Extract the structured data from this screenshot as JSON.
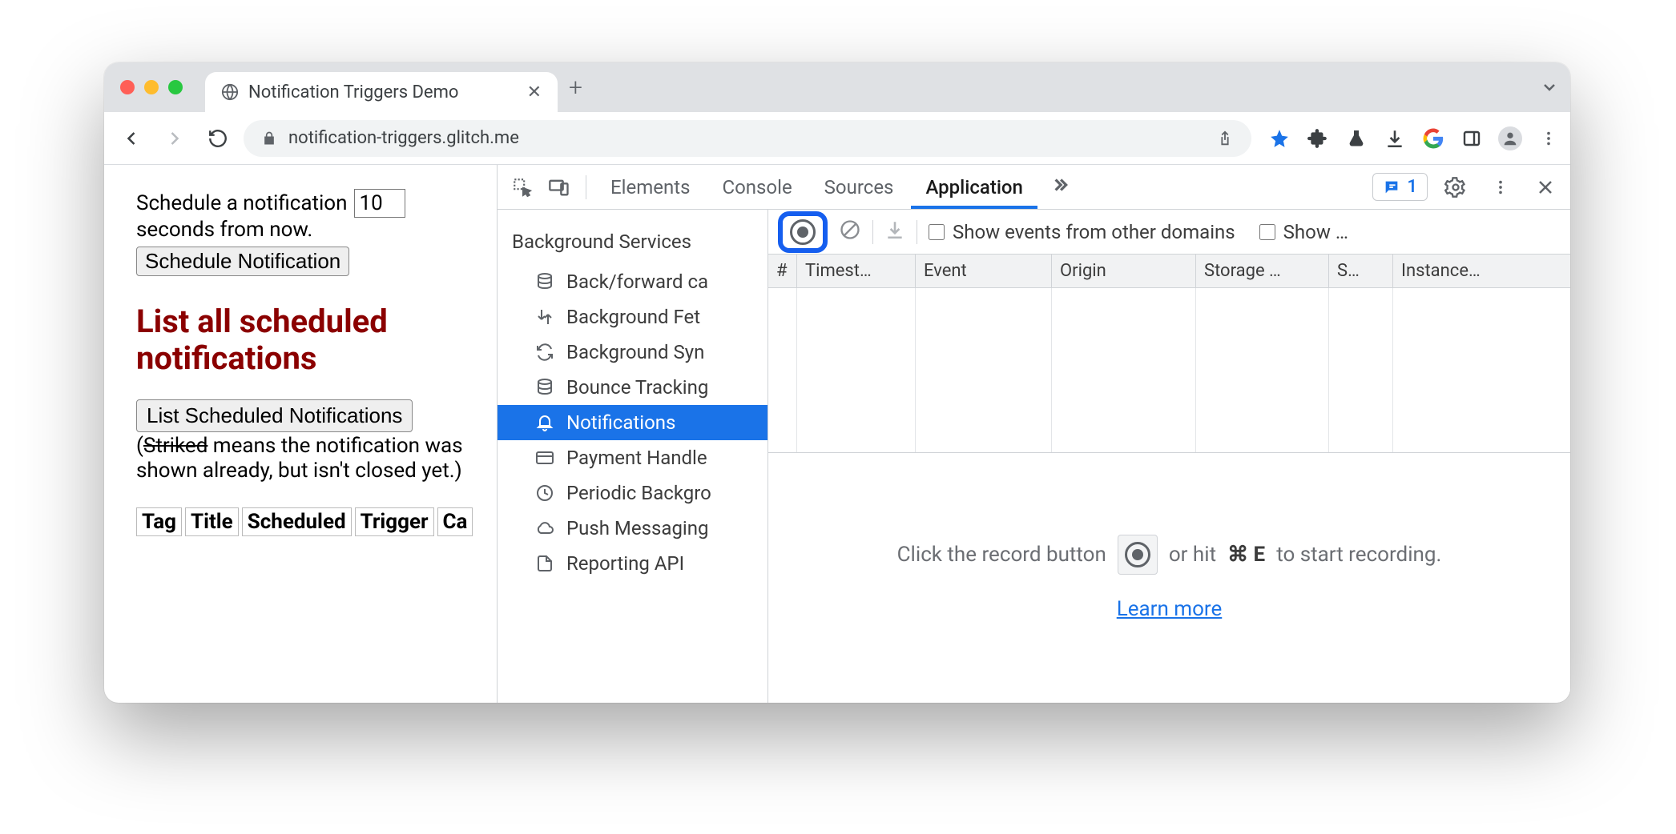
{
  "tab": {
    "title": "Notification Triggers Demo"
  },
  "omnibox": {
    "url": "notification-triggers.glitch.me"
  },
  "page": {
    "schedule_text_a": "Schedule a notification",
    "schedule_seconds": "10",
    "schedule_text_b": "seconds from now.",
    "schedule_button": "Schedule Notification",
    "heading": "List all scheduled notifications",
    "list_button": "List Scheduled Notifications",
    "note_open": "(",
    "note_striked": "Striked",
    "note_rest": " means the notification was shown already, but isn't closed yet.)",
    "thead": [
      "Tag",
      "Title",
      "Scheduled",
      "Trigger",
      "Ca"
    ]
  },
  "devtools": {
    "tabs": [
      "Elements",
      "Console",
      "Sources",
      "Application"
    ],
    "active_tab": "Application",
    "issue_count": "1",
    "sidebar": {
      "category": "Background Services",
      "items": [
        "Back/forward ca",
        "Background Fet",
        "Background Syn",
        "Bounce Tracking",
        "Notifications",
        "Payment Handle",
        "Periodic Backgro",
        "Push Messaging",
        "Reporting API"
      ],
      "selected_index": 4
    },
    "toolbar": {
      "show_other_domains": "Show events from other domains",
      "show_truncated": "Show …"
    },
    "columns": [
      "#",
      "Timest…",
      "Event",
      "Origin",
      "Storage …",
      "S…",
      "Instance…"
    ],
    "empty": {
      "prefix": "Click the record button",
      "middle": "or hit",
      "cmd": "⌘ E",
      "suffix": "to start recording.",
      "learn_more": "Learn more"
    }
  }
}
